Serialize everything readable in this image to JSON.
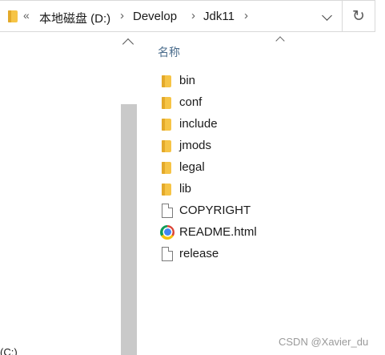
{
  "address_bar": {
    "overflow_chevron": "«",
    "breadcrumb": [
      {
        "label": "本地磁盘 (D:)"
      },
      {
        "label": "Develop"
      },
      {
        "label": "Jdk11"
      }
    ],
    "separator": "›",
    "refresh_glyph": "↻"
  },
  "list": {
    "column_header": "名称",
    "files": [
      {
        "name": "bin",
        "icon": "folder-icon"
      },
      {
        "name": "conf",
        "icon": "folder-icon"
      },
      {
        "name": "include",
        "icon": "folder-icon"
      },
      {
        "name": "jmods",
        "icon": "folder-icon"
      },
      {
        "name": "legal",
        "icon": "folder-icon"
      },
      {
        "name": "lib",
        "icon": "folder-icon"
      },
      {
        "name": "COPYRIGHT",
        "icon": "document-icon"
      },
      {
        "name": "README.html",
        "icon": "chrome-icon"
      },
      {
        "name": "release",
        "icon": "document-icon"
      }
    ]
  },
  "nav_pane": {
    "partial_item": "(C:)"
  },
  "watermark": "CSDN @Xavier_du",
  "colors": {
    "folder": "#f6c446",
    "header_text": "#4a6c8c",
    "scroll_thumb": "#c9c9c9"
  }
}
